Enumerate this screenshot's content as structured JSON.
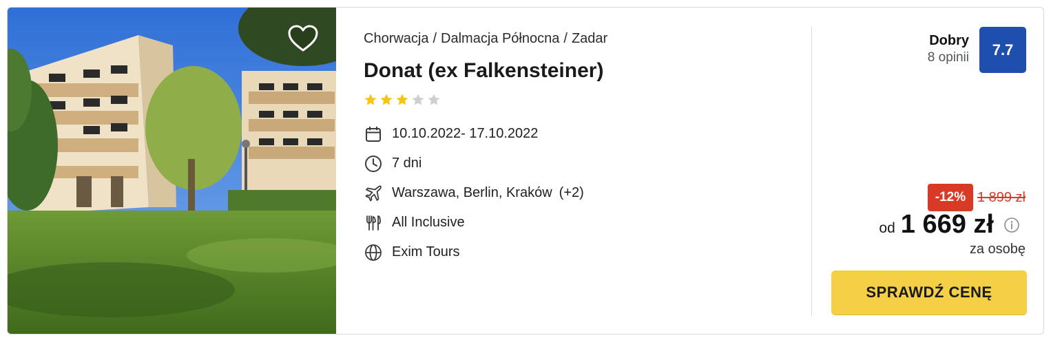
{
  "hotel": {
    "breadcrumb": [
      "Chorwacja",
      "Dalmacja Północna",
      "Zadar"
    ],
    "breadcrumb_separator": "/",
    "name": "Donat (ex Falkensteiner)",
    "stars_total": 5,
    "stars_filled": 3,
    "star_color": "#f5c518",
    "star_empty_color": "#cfcfcf"
  },
  "facts": {
    "dates": "10.10.2022- 17.10.2022",
    "duration": "7 dni",
    "departure": "Warszawa, Berlin, Kraków",
    "departure_more": "(+2)",
    "board": "All Inclusive",
    "operator": "Exim Tours"
  },
  "rating": {
    "label": "Dobry",
    "count": "8 opinii",
    "score": "7.7",
    "badge_color": "#1f4fae"
  },
  "price": {
    "discount": "-12%",
    "old": "1 899 zł",
    "prefix": "od",
    "current": "1 669 zł",
    "per": "za osobę",
    "cta": "SPRAWDŹ CENĘ",
    "cta_color": "#f5cf45",
    "discount_color": "#d83a26"
  },
  "icons": {
    "favorite": "heart-icon",
    "dates": "calendar-icon",
    "duration": "clock-icon",
    "departure": "plane-icon",
    "board": "cutlery-icon",
    "operator": "globe-icon",
    "price_info": "info-icon",
    "rating_star": "star-icon"
  }
}
